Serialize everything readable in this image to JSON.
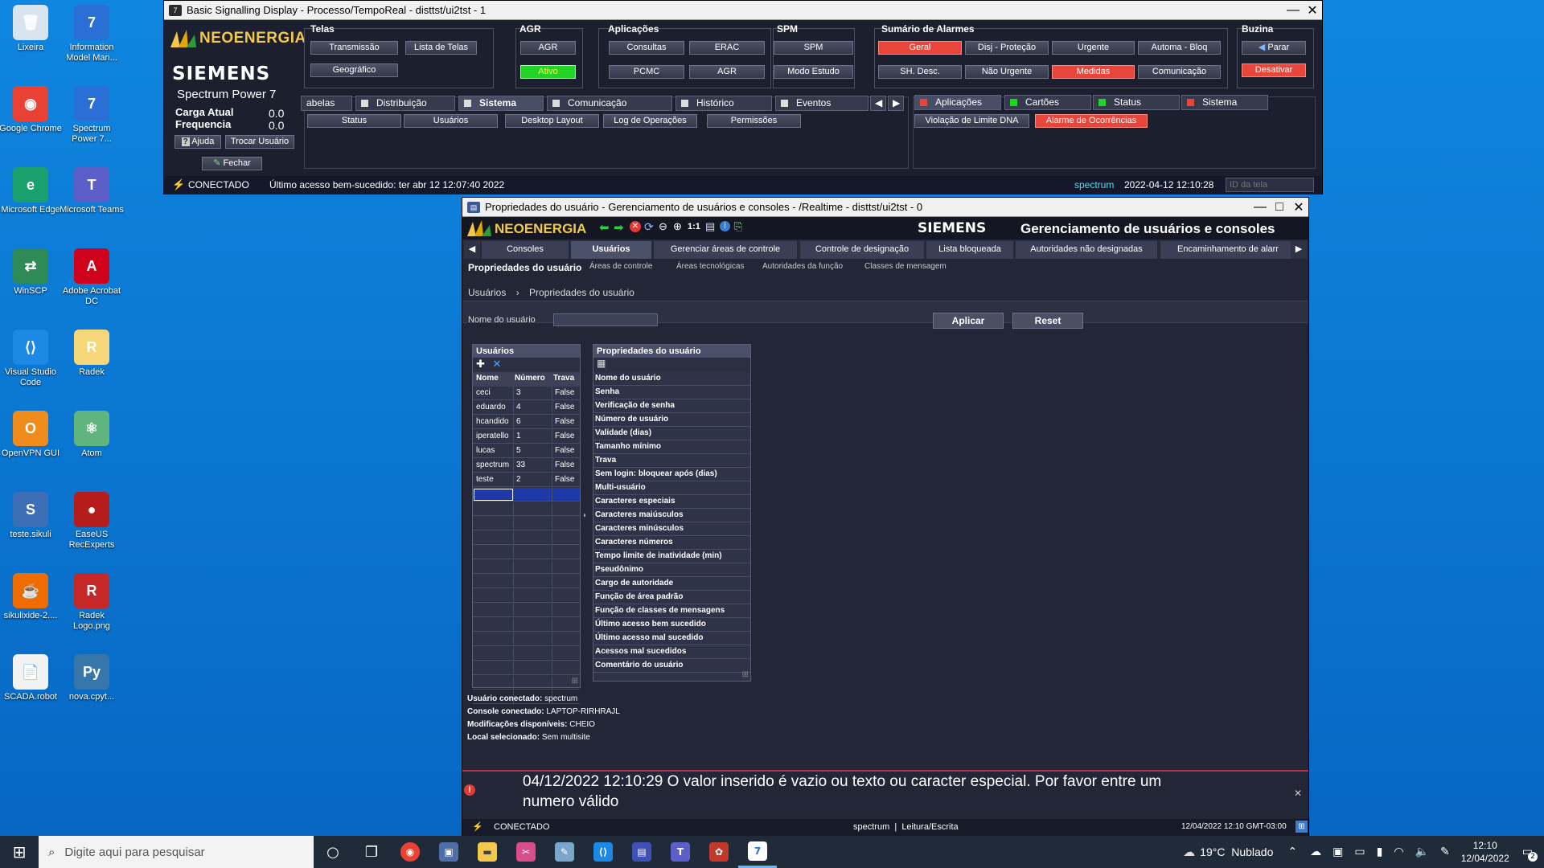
{
  "desktop": {
    "icons": [
      {
        "label": "Lixeira",
        "glyph": "🗑",
        "color": "#d8e4ee"
      },
      {
        "label": "Information Model Man...",
        "glyph": "7",
        "color": "#2a6fd6"
      },
      {
        "label": "Google Chrome",
        "glyph": "◉",
        "color": "#e94235"
      },
      {
        "label": "Spectrum Power 7...",
        "glyph": "7",
        "color": "#2a6fd6"
      },
      {
        "label": "Microsoft Edge",
        "glyph": "e",
        "color": "#1aa06d"
      },
      {
        "label": "Microsoft Teams",
        "glyph": "T",
        "color": "#5b5fc7"
      },
      {
        "label": "WinSCP",
        "glyph": "⇄",
        "color": "#2e8b57"
      },
      {
        "label": "Adobe Acrobat DC",
        "glyph": "A",
        "color": "#d0021b"
      },
      {
        "label": "Visual Studio Code",
        "glyph": "⟨⟩",
        "color": "#1e88e5"
      },
      {
        "label": "Radek",
        "glyph": "R",
        "color": "#f5d77a"
      },
      {
        "label": "OpenVPN GUI",
        "glyph": "O",
        "color": "#f08c1c"
      },
      {
        "label": "Atom",
        "glyph": "⚛",
        "color": "#5fb57d"
      },
      {
        "label": "teste.sikuli",
        "glyph": "S",
        "color": "#3d6fb6"
      },
      {
        "label": "EaseUS RecExperts",
        "glyph": "●",
        "color": "#b71c1c"
      },
      {
        "label": "sikulixide-2....",
        "glyph": "☕",
        "color": "#ef6c00"
      },
      {
        "label": "Radek Logo.png",
        "glyph": "R",
        "color": "#c62828"
      },
      {
        "label": "SCADA.robot",
        "glyph": "📄",
        "color": "#f2f2f2"
      },
      {
        "label": "nova.cpyt...",
        "glyph": "Py",
        "color": "#3776ab"
      }
    ]
  },
  "win1": {
    "title": "Basic Signalling Display - Processo/TempoReal - disttst/ui2tst - 1",
    "brand": "NEOENERGIA",
    "siemens": "SIEMENS",
    "product": "Spectrum Power 7",
    "carga_label": "Carga Atual",
    "carga_value": "0.0",
    "freq_label": "Frequencia",
    "freq_value": "0.0",
    "ajuda": "Ajuda",
    "trocar": "Trocar Usuário",
    "fechar": "Fechar",
    "groups": {
      "telas": "Telas",
      "agr": "AGR",
      "aplicacoes": "Aplicações",
      "spm": "SPM",
      "alarmes": "Sumário de Alarmes",
      "buzina": "Buzina"
    },
    "buttons": {
      "transmissao": "Transmissão",
      "lista_telas": "Lista de Telas",
      "geografico": "Geográfico",
      "agr": "AGR",
      "ativo": "Ativo",
      "consultas": "Consultas",
      "erac": "ERAC",
      "pcmc": "PCMC",
      "agr2": "AGR",
      "spm": "SPM",
      "modo_estudo": "Modo Estudo",
      "geral": "Geral",
      "disj": "Disj - Proteção",
      "urgente": "Urgente",
      "automa": "Automa - Bloq",
      "sh_desc": "SH. Desc.",
      "nao_urgente": "Não Urgente",
      "medidas": "Medidas",
      "comunicacao": "Comunicação",
      "parar": "Parar",
      "desativar": "Desativar"
    },
    "tabs": [
      "abelas",
      "Distribuição",
      "Sistema",
      "Comunicação",
      "Histórico",
      "Eventos"
    ],
    "subbuttons": [
      "Status",
      "Usuários",
      "Desktop Layout",
      "Log de Operações",
      "Permissões"
    ],
    "right_tabs": [
      "Aplicações",
      "Cartões",
      "Status",
      "Sistema"
    ],
    "right_buttons": [
      "Violação de Limite DNA",
      "Alarme de Ocorrências"
    ],
    "status": "CONECTADO",
    "last_access": "Último acesso bem-sucedido: ter abr 12 12:07:40 2022",
    "user": "spectrum",
    "datetime": "2022-04-12 12:10:28",
    "screen_id_placeholder": "ID da tela"
  },
  "win2": {
    "title": "Propriedades do usuário - Gerenciamento de usuários e consoles - /Realtime - disttst/ui2tst - 0",
    "brand": "NEOENERGIA",
    "zoom": "1:1",
    "siemens": "SIEMENS",
    "header_title": "Gerenciamento de usuários e consoles",
    "tabs": [
      "Consoles",
      "Usuários",
      "Gerenciar áreas de controle",
      "Controle de designação",
      "Lista bloqueada",
      "Autoridades não designadas",
      "Encaminhamento de alarr"
    ],
    "subtabs": [
      "Propriedades do usuário",
      "Áreas de controle",
      "Áreas tecnológicas",
      "Autoridades da função",
      "Classes de mensagem"
    ],
    "breadcrumb": [
      "Usuários",
      "Propriedades do usuário"
    ],
    "username_label": "Nome do usuário",
    "aplicar": "Aplicar",
    "reset": "Reset",
    "users_title": "Usuários",
    "users_cols": [
      "Nome",
      "Número",
      "Trava"
    ],
    "users": [
      [
        "ceci",
        "3",
        "False"
      ],
      [
        "eduardo",
        "4",
        "False"
      ],
      [
        "hcandido",
        "6",
        "False"
      ],
      [
        "iperatello",
        "1",
        "False"
      ],
      [
        "lucas",
        "5",
        "False"
      ],
      [
        "spectrum",
        "33",
        "False"
      ],
      [
        "teste",
        "2",
        "False"
      ]
    ],
    "props_title": "Propriedades do usuário",
    "props": [
      "Nome do usuário",
      "Senha",
      "Verificação de senha",
      "Número de usuário",
      "Validade (dias)",
      "Tamanho mínimo",
      "Trava",
      "Sem login: bloquear após (dias)",
      "Multi-usuário",
      "Caracteres especiais",
      "Caracteres maiúsculos",
      "Caracteres minúsculos",
      "Caracteres números",
      "Tempo limite de inatividade (min)",
      "Pseudônimo",
      "Cargo de autoridade",
      "Função de área padrão",
      "Função de classes de mensagens",
      "Último acesso bem sucedido",
      "Último acesso mal sucedido",
      "Acessos mal sucedidos",
      "Comentário do usuário"
    ],
    "info": [
      {
        "label": "Usuário conectado:",
        "value": "spectrum"
      },
      {
        "label": "Console conectado:",
        "value": "LAPTOP-RIRHRAJL"
      },
      {
        "label": "Modificações disponíveis:",
        "value": "CHEIO"
      },
      {
        "label": "Local selecionado:",
        "value": "Sem multisite"
      }
    ],
    "message_line1": "04/12/2022 12:10:29 O valor inserido é vazio ou texto ou caracter especial. Por favor entre um",
    "message_line2": "numero válido",
    "status": "CONECTADO",
    "user_mode": "spectrum  |  Leitura/Escrita",
    "datetime": "12/04/2022 12:10 GMT-03:00"
  },
  "taskbar": {
    "search_placeholder": "Digite aqui para pesquisar",
    "weather": "19°C  Nublado",
    "time": "12:10",
    "date": "12/04/2022",
    "notif_count": "2"
  },
  "colors": {
    "accent_red": "#e8463b",
    "active_green": "#22d425",
    "brand_yellow": "#f2c94c",
    "brand_green": "#2e9b3a"
  }
}
